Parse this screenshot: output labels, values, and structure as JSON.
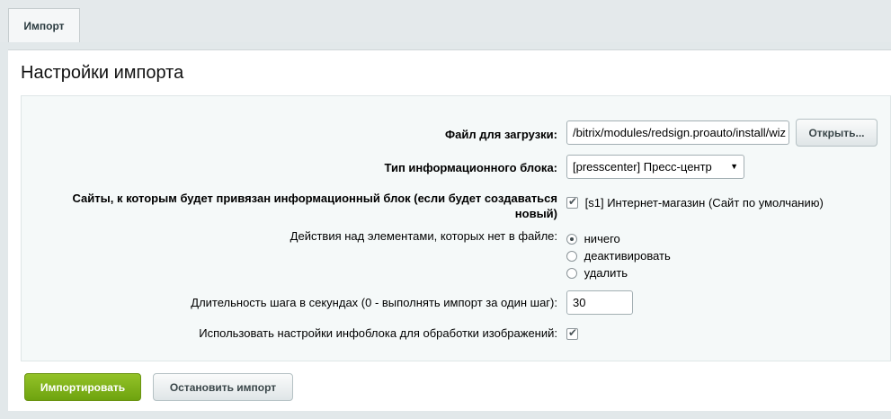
{
  "tabs": [
    {
      "label": "Импорт"
    }
  ],
  "panel": {
    "title": "Настройки импорта"
  },
  "form": {
    "file": {
      "label": "Файл для загрузки:",
      "value": "/bitrix/modules/redsign.proauto/install/wiz",
      "open_button": "Открыть..."
    },
    "iblock_type": {
      "label": "Тип информационного блока:",
      "selected": "[presscenter] Пресс-центр"
    },
    "sites": {
      "label": "Сайты, к которым будет привязан информационный блок (если будет создаваться новый)",
      "option": "[s1] Интернет-магазин (Сайт по умолчанию)",
      "checked": true
    },
    "missing_action": {
      "label": "Действия над элементами, которых нет в файле:",
      "options": [
        "ничего",
        "деактивировать",
        "удалить"
      ],
      "selected": "ничего"
    },
    "step_duration": {
      "label": "Длительность шага в секундах (0 - выполнять импорт за один шаг):",
      "value": "30"
    },
    "use_iblock_settings": {
      "label": "Использовать настройки инфоблока для обработки изображений:",
      "checked": true
    }
  },
  "actions": {
    "import": "Импортировать",
    "stop": "Остановить импорт"
  },
  "colors": {
    "primary_button": "#7bb11a",
    "background": "#e2e8ea"
  }
}
